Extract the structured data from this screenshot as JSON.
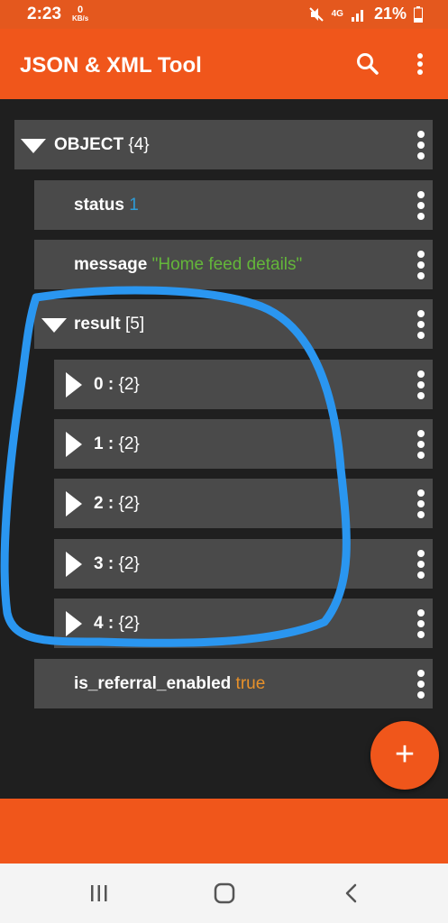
{
  "status_bar": {
    "time": "2:23",
    "net_speed_value": "0",
    "net_speed_unit": "KB/s",
    "network_type": "4G",
    "battery_percent": "21%"
  },
  "app_bar": {
    "title": "JSON & XML Tool",
    "icons": [
      "search-icon",
      "more-vert-icon"
    ]
  },
  "tree": {
    "root": {
      "label": "OBJECT",
      "count": "{4}"
    },
    "status": {
      "key": "status",
      "value": "1"
    },
    "message": {
      "key": "message",
      "value": "\"Home feed details\""
    },
    "result": {
      "key": "result",
      "count": "[5]"
    },
    "result_items": [
      {
        "index": "0 :",
        "count": "{2}"
      },
      {
        "index": "1 :",
        "count": "{2}"
      },
      {
        "index": "2 :",
        "count": "{2}"
      },
      {
        "index": "3 :",
        "count": "{2}"
      },
      {
        "index": "4 :",
        "count": "{2}"
      }
    ],
    "is_referral_enabled": {
      "key": "is_referral_enabled",
      "value": "true"
    }
  },
  "fab": {
    "label": "+"
  },
  "colors": {
    "accent": "#f0561b",
    "row_bg": "#4a4a4a",
    "number_value": "#2e9bd6",
    "string_value": "#64b73a",
    "boolean_value": "#e8912a",
    "annotation_stroke": "#2a96f0"
  },
  "nav_bar": {
    "icons": [
      "recent-apps-icon",
      "home-icon",
      "back-icon"
    ]
  }
}
